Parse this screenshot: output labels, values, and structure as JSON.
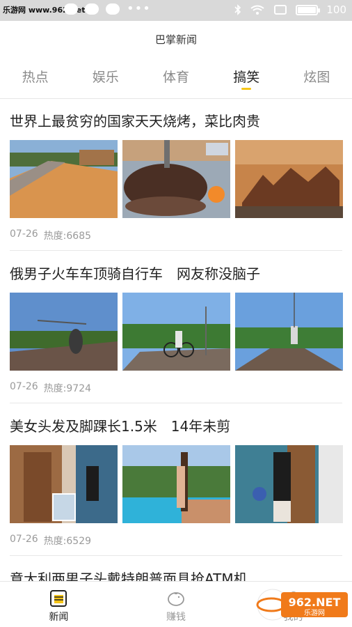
{
  "status_bar": {
    "watermark": "乐游网 www.962.net",
    "battery_level": "100"
  },
  "app": {
    "title": "巴掌新闻"
  },
  "tabs": [
    {
      "label": "热点",
      "active": false
    },
    {
      "label": "娱乐",
      "active": false
    },
    {
      "label": "体育",
      "active": false
    },
    {
      "label": "搞笑",
      "active": true
    },
    {
      "label": "炫图",
      "active": false
    }
  ],
  "articles": [
    {
      "title": "世界上最贫穷的国家天天烧烤，菜比肉贵",
      "date": "07-26",
      "heat": "热度:6685",
      "images": [
        "dirt-road-photo",
        "roasting-meat-photo",
        "grilled-meat-rack-photo"
      ]
    },
    {
      "title": "俄男子火车车顶骑自行车　网友称没脑子",
      "date": "07-26",
      "heat": "热度:9724",
      "images": [
        "train-roof-cyclist-photo-1",
        "train-roof-cyclist-photo-2",
        "train-roof-cyclist-photo-3"
      ]
    },
    {
      "title": "美女头发及脚踝长1.5米　14年未剪",
      "date": "07-26",
      "heat": "热度:6529",
      "images": [
        "long-hair-woman-photo-1",
        "long-hair-woman-pool-photo",
        "long-hair-woman-photo-2"
      ]
    },
    {
      "title": "意大利两男子头戴特朗普面具抢ATM机"
    }
  ],
  "bottom_nav": [
    {
      "label": "新闻",
      "icon": "news-icon",
      "active": true
    },
    {
      "label": "赚钱",
      "icon": "piggy-bank-icon",
      "active": false
    },
    {
      "label": "我的",
      "icon": "profile-icon",
      "active": false
    }
  ],
  "overlay_logo": {
    "text": "962.NET",
    "subtext": "乐游网"
  },
  "colors": {
    "accent": "#f5c518",
    "status_bar": "#d9d9d9",
    "muted": "#9a9a9a"
  }
}
